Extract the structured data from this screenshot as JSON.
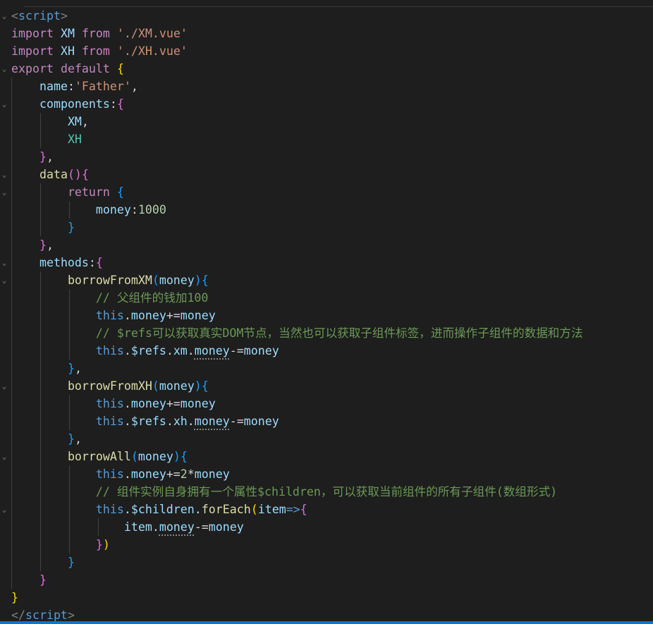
{
  "editor": {
    "lines": [
      {
        "fold": true,
        "guides": 0,
        "t": [
          [
            "tag",
            "<"
          ],
          [
            "kw-b",
            "script"
          ],
          [
            "tag",
            ">"
          ]
        ]
      },
      {
        "fold": false,
        "guides": 0,
        "t": [
          [
            "kw-c",
            "import"
          ],
          [
            "txt",
            " "
          ],
          [
            "var",
            "XM"
          ],
          [
            "txt",
            " "
          ],
          [
            "kw-c",
            "from"
          ],
          [
            "txt",
            " "
          ],
          [
            "str",
            "'./XM.vue'"
          ]
        ]
      },
      {
        "fold": false,
        "guides": 0,
        "t": [
          [
            "kw-c",
            "import"
          ],
          [
            "txt",
            " "
          ],
          [
            "var",
            "XH"
          ],
          [
            "txt",
            " "
          ],
          [
            "kw-c",
            "from"
          ],
          [
            "txt",
            " "
          ],
          [
            "str",
            "'./XH.vue'"
          ]
        ]
      },
      {
        "fold": true,
        "guides": 0,
        "t": [
          [
            "kw-c",
            "export"
          ],
          [
            "txt",
            " "
          ],
          [
            "kw-c",
            "default"
          ],
          [
            "txt",
            " "
          ],
          [
            "br1",
            "{"
          ]
        ]
      },
      {
        "fold": false,
        "guides": 1,
        "t": [
          [
            "txt",
            "    "
          ],
          [
            "var",
            "name"
          ],
          [
            "txt",
            ":"
          ],
          [
            "str",
            "'Father'"
          ],
          [
            "txt",
            ","
          ]
        ]
      },
      {
        "fold": true,
        "guides": 1,
        "t": [
          [
            "txt",
            "    "
          ],
          [
            "var",
            "components"
          ],
          [
            "txt",
            ":"
          ],
          [
            "br2",
            "{"
          ]
        ]
      },
      {
        "fold": false,
        "guides": 2,
        "t": [
          [
            "txt",
            "        "
          ],
          [
            "var",
            "XM"
          ],
          [
            "txt",
            ","
          ]
        ]
      },
      {
        "fold": false,
        "guides": 2,
        "t": [
          [
            "txt",
            "        "
          ],
          [
            "cls",
            "XH"
          ]
        ]
      },
      {
        "fold": false,
        "guides": 1,
        "t": [
          [
            "txt",
            "    "
          ],
          [
            "br2",
            "}"
          ],
          [
            "txt",
            ","
          ]
        ]
      },
      {
        "fold": true,
        "guides": 1,
        "t": [
          [
            "txt",
            "    "
          ],
          [
            "fn",
            "data"
          ],
          [
            "br2",
            "()"
          ],
          [
            "br2",
            "{"
          ]
        ]
      },
      {
        "fold": true,
        "guides": 2,
        "t": [
          [
            "txt",
            "        "
          ],
          [
            "kw-c",
            "return"
          ],
          [
            "txt",
            " "
          ],
          [
            "br3",
            "{"
          ]
        ]
      },
      {
        "fold": false,
        "guides": 3,
        "t": [
          [
            "txt",
            "            "
          ],
          [
            "var",
            "money"
          ],
          [
            "txt",
            ":"
          ],
          [
            "num",
            "1000"
          ]
        ]
      },
      {
        "fold": false,
        "guides": 2,
        "t": [
          [
            "txt",
            "        "
          ],
          [
            "br3",
            "}"
          ]
        ]
      },
      {
        "fold": false,
        "guides": 1,
        "t": [
          [
            "txt",
            "    "
          ],
          [
            "br2",
            "}"
          ],
          [
            "txt",
            ","
          ]
        ]
      },
      {
        "fold": true,
        "guides": 1,
        "t": [
          [
            "txt",
            "    "
          ],
          [
            "var",
            "methods"
          ],
          [
            "txt",
            ":"
          ],
          [
            "br2",
            "{"
          ]
        ]
      },
      {
        "fold": true,
        "guides": 2,
        "t": [
          [
            "txt",
            "        "
          ],
          [
            "fn",
            "borrowFromXM"
          ],
          [
            "br3",
            "("
          ],
          [
            "var",
            "money"
          ],
          [
            "br3",
            ")"
          ],
          [
            "br3",
            "{"
          ]
        ]
      },
      {
        "fold": false,
        "guides": 3,
        "t": [
          [
            "txt",
            "            "
          ],
          [
            "com",
            "// 父组件的钱加100"
          ]
        ]
      },
      {
        "fold": false,
        "guides": 3,
        "t": [
          [
            "txt",
            "            "
          ],
          [
            "kw-b",
            "this"
          ],
          [
            "txt",
            "."
          ],
          [
            "var",
            "money"
          ],
          [
            "txt",
            "+="
          ],
          [
            "var",
            "money"
          ]
        ]
      },
      {
        "fold": false,
        "guides": 3,
        "t": [
          [
            "txt",
            "            "
          ],
          [
            "com",
            "// $refs可以获取真实DOM节点，当然也可以获取子组件标签，进而操作子组件的数据和方法"
          ]
        ]
      },
      {
        "fold": false,
        "guides": 3,
        "t": [
          [
            "txt",
            "            "
          ],
          [
            "kw-b",
            "this"
          ],
          [
            "txt",
            "."
          ],
          [
            "var",
            "$refs"
          ],
          [
            "txt",
            "."
          ],
          [
            "var",
            "xm"
          ],
          [
            "txt",
            "."
          ],
          [
            "var wavy",
            "money"
          ],
          [
            "txt",
            "-="
          ],
          [
            "var",
            "money"
          ]
        ]
      },
      {
        "fold": false,
        "guides": 2,
        "t": [
          [
            "txt",
            "        "
          ],
          [
            "br3",
            "}"
          ],
          [
            "txt",
            ","
          ]
        ]
      },
      {
        "fold": true,
        "guides": 2,
        "t": [
          [
            "txt",
            "        "
          ],
          [
            "fn",
            "borrowFromXH"
          ],
          [
            "br3",
            "("
          ],
          [
            "var",
            "money"
          ],
          [
            "br3",
            ")"
          ],
          [
            "br3",
            "{"
          ]
        ]
      },
      {
        "fold": false,
        "guides": 3,
        "t": [
          [
            "txt",
            "            "
          ],
          [
            "kw-b",
            "this"
          ],
          [
            "txt",
            "."
          ],
          [
            "var",
            "money"
          ],
          [
            "txt",
            "+="
          ],
          [
            "var",
            "money"
          ]
        ]
      },
      {
        "fold": false,
        "guides": 3,
        "t": [
          [
            "txt",
            "            "
          ],
          [
            "kw-b",
            "this"
          ],
          [
            "txt",
            "."
          ],
          [
            "var",
            "$refs"
          ],
          [
            "txt",
            "."
          ],
          [
            "var",
            "xh"
          ],
          [
            "txt",
            "."
          ],
          [
            "var wavy",
            "money"
          ],
          [
            "txt",
            "-="
          ],
          [
            "var",
            "money"
          ]
        ]
      },
      {
        "fold": false,
        "guides": 2,
        "t": [
          [
            "txt",
            "        "
          ],
          [
            "br3",
            "}"
          ],
          [
            "txt",
            ","
          ]
        ]
      },
      {
        "fold": true,
        "guides": 2,
        "t": [
          [
            "txt",
            "        "
          ],
          [
            "fn",
            "borrowAll"
          ],
          [
            "br3",
            "("
          ],
          [
            "var",
            "money"
          ],
          [
            "br3",
            ")"
          ],
          [
            "br3",
            "{"
          ]
        ]
      },
      {
        "fold": false,
        "guides": 3,
        "t": [
          [
            "txt",
            "            "
          ],
          [
            "kw-b",
            "this"
          ],
          [
            "txt",
            "."
          ],
          [
            "var",
            "money"
          ],
          [
            "txt",
            "+="
          ],
          [
            "num",
            "2"
          ],
          [
            "txt",
            "*"
          ],
          [
            "var",
            "money"
          ]
        ]
      },
      {
        "fold": false,
        "guides": 3,
        "t": [
          [
            "txt",
            "            "
          ],
          [
            "com",
            "// 组件实例自身拥有一个属性$children，可以获取当前组件的所有子组件(数组形式)"
          ]
        ]
      },
      {
        "fold": true,
        "guides": 3,
        "t": [
          [
            "txt",
            "            "
          ],
          [
            "kw-b",
            "this"
          ],
          [
            "txt",
            "."
          ],
          [
            "var",
            "$children"
          ],
          [
            "txt",
            "."
          ],
          [
            "fn",
            "forEach"
          ],
          [
            "br1",
            "("
          ],
          [
            "var",
            "item"
          ],
          [
            "kw-b",
            "=>"
          ],
          [
            "br2",
            "{"
          ]
        ]
      },
      {
        "fold": false,
        "guides": 4,
        "t": [
          [
            "txt",
            "                "
          ],
          [
            "var",
            "item"
          ],
          [
            "txt",
            "."
          ],
          [
            "var wavy",
            "money"
          ],
          [
            "txt",
            "-="
          ],
          [
            "var",
            "money"
          ]
        ]
      },
      {
        "fold": false,
        "guides": 3,
        "t": [
          [
            "txt",
            "            "
          ],
          [
            "br2",
            "}"
          ],
          [
            "br1",
            ")"
          ]
        ]
      },
      {
        "fold": false,
        "guides": 2,
        "t": [
          [
            "txt",
            "        "
          ],
          [
            "br3",
            "}"
          ]
        ]
      },
      {
        "fold": false,
        "guides": 1,
        "t": [
          [
            "txt",
            "    "
          ],
          [
            "br2",
            "}"
          ]
        ]
      },
      {
        "fold": false,
        "guides": 0,
        "t": [
          [
            "br1",
            "}"
          ]
        ]
      },
      {
        "fold": false,
        "guides": 0,
        "t": [
          [
            "tag",
            "</"
          ],
          [
            "kw-b",
            "script"
          ],
          [
            "tag",
            ">"
          ]
        ]
      }
    ]
  },
  "icons": {
    "fold": "chevron-down-icon",
    "fold_glyph": "⌄"
  },
  "colors": {
    "background": "#1e1e1e",
    "status_bar": "#007acc"
  }
}
